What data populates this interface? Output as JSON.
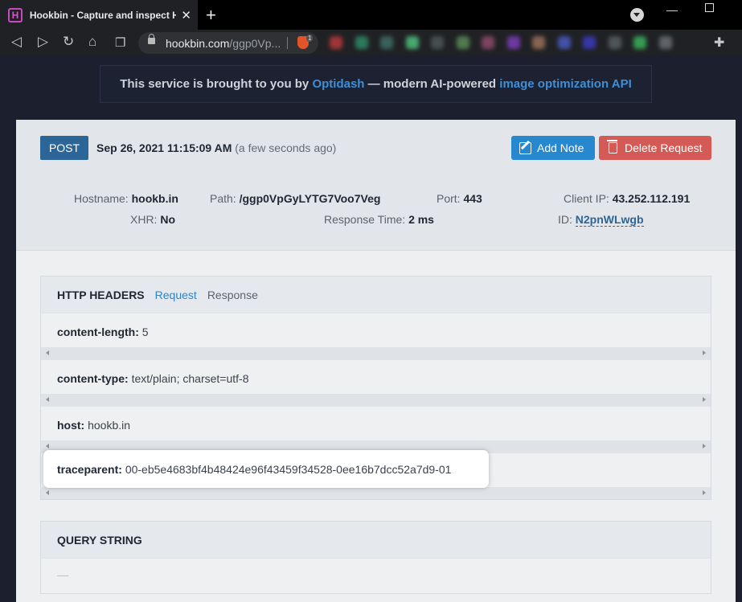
{
  "browser": {
    "tab_title": "Hookbin - Capture and inspect HTTP",
    "tab_favicon_letter": "H",
    "url_host": "hookbin.com",
    "url_path": "/ggp0Vp...",
    "shields_count": "1",
    "extension_colors": [
      "#b8393b",
      "#2e8a66",
      "#3f6d66",
      "#4fbf7d",
      "#4f5555",
      "#5a8a55",
      "#8c4a6c",
      "#7a3db8",
      "#9a6f5a",
      "#4a5abf",
      "#3a3ac0",
      "#5a5f63",
      "#3ab05a",
      "#6a6f73"
    ]
  },
  "banner": {
    "prefix": "This service is brought to you by ",
    "brand": "Optidash",
    "middle": " — modern AI-powered ",
    "link": "image optimization API"
  },
  "request": {
    "method": "POST",
    "datetime": "Sep 26, 2021 11:15:09 AM",
    "relative": "(a few seconds ago)",
    "add_note_label": "Add Note",
    "delete_label": "Delete Request"
  },
  "meta": {
    "hostname_label": "Hostname:",
    "hostname_value": "hookb.in",
    "path_label": "Path:",
    "path_value": "/ggp0VpGyLYTG7Voo7Veg",
    "port_label": "Port:",
    "port_value": "443",
    "client_ip_label": "Client IP:",
    "client_ip_value": "43.252.112.191",
    "xhr_label": "XHR:",
    "xhr_value": "No",
    "response_time_label": "Response Time:",
    "response_time_value": "2 ms",
    "id_label": "ID:",
    "id_value": "N2pnWLwgb"
  },
  "headers_panel": {
    "title": "HTTP HEADERS",
    "tab_request": "Request",
    "tab_response": "Response",
    "rows": [
      {
        "key": "content-length:",
        "value": "5"
      },
      {
        "key": "content-type:",
        "value": "text/plain; charset=utf-8"
      },
      {
        "key": "host:",
        "value": "hookb.in"
      },
      {
        "key": "traceparent:",
        "value": "00-eb5e4683bf4b48424e96f43459f34528-0ee16b7dcc52a7d9-01"
      }
    ]
  },
  "query_panel": {
    "title": "QUERY STRING",
    "empty": "—"
  }
}
